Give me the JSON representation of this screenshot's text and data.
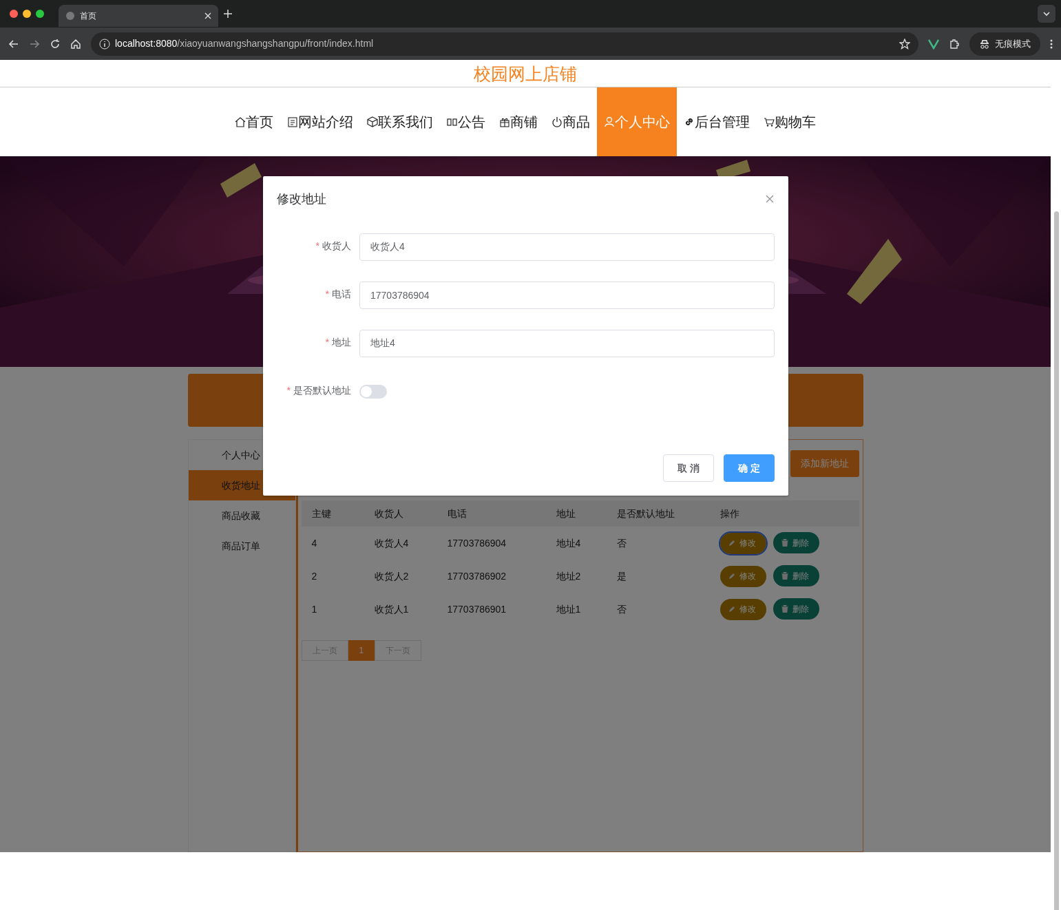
{
  "browser": {
    "tab_title": "首页",
    "url_host": "localhost:8080",
    "url_path": "/xiaoyuanwangshangshangpu/front/index.html",
    "profile_label": "无痕模式"
  },
  "site_title": "校园网上店铺",
  "nav": [
    {
      "label": "首页",
      "selected": false
    },
    {
      "label": "网站介绍",
      "selected": false
    },
    {
      "label": "联系我们",
      "selected": false
    },
    {
      "label": "公告",
      "selected": false
    },
    {
      "label": "商铺",
      "selected": false
    },
    {
      "label": "商品",
      "selected": false
    },
    {
      "label": "个人中心",
      "selected": true
    },
    {
      "label": "后台管理",
      "selected": false
    },
    {
      "label": "购物车",
      "selected": false
    }
  ],
  "sidebar": [
    {
      "label": "个人中心",
      "selected": false
    },
    {
      "label": "收货地址",
      "selected": true
    },
    {
      "label": "商品收藏",
      "selected": false
    },
    {
      "label": "商品订单",
      "selected": false
    }
  ],
  "add_button": "添加新地址",
  "table": {
    "columns": [
      "主键",
      "收货人",
      "电话",
      "地址",
      "是否默认地址",
      "操作"
    ],
    "rows": [
      {
        "cells": [
          "4",
          "收货人4",
          "17703786904",
          "地址4",
          "否"
        ],
        "edit": "修改",
        "delete": "删除",
        "focused": true
      },
      {
        "cells": [
          "2",
          "收货人2",
          "17703786902",
          "地址2",
          "是"
        ],
        "edit": "修改",
        "delete": "删除",
        "focused": false
      },
      {
        "cells": [
          "1",
          "收货人1",
          "17703786901",
          "地址1",
          "否"
        ],
        "edit": "修改",
        "delete": "删除",
        "focused": false
      }
    ]
  },
  "pagination": {
    "prev": "上一页",
    "pages": [
      {
        "label": "1",
        "selected": true
      }
    ],
    "next": "下一页"
  },
  "dialog": {
    "title": "修改地址",
    "required_mark": "*",
    "fields": [
      {
        "label": "收货人",
        "required": true,
        "kind": "text",
        "value": "收货人4"
      },
      {
        "label": "电话",
        "required": true,
        "kind": "text",
        "value": "17703786904"
      },
      {
        "label": "地址",
        "required": true,
        "kind": "text",
        "value": "地址4"
      },
      {
        "label": "是否默认地址",
        "required": true,
        "kind": "switch",
        "on": false
      }
    ],
    "buttons": [
      {
        "label": "取 消",
        "kind": "default"
      },
      {
        "label": "确 定",
        "kind": "primary"
      }
    ]
  }
}
